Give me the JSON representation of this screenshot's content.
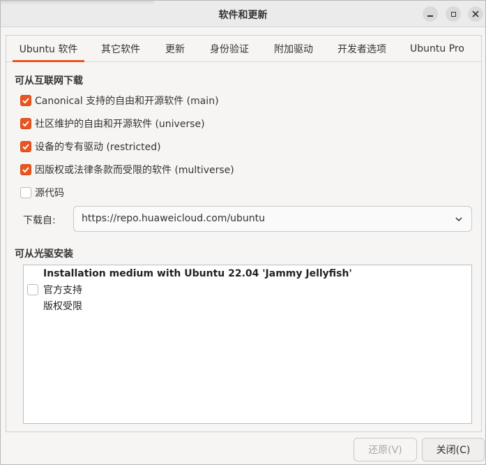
{
  "window": {
    "title": "软件和更新"
  },
  "tabs": [
    {
      "label": "Ubuntu 软件",
      "active": true
    },
    {
      "label": "其它软件",
      "active": false
    },
    {
      "label": "更新",
      "active": false
    },
    {
      "label": "身份验证",
      "active": false
    },
    {
      "label": "附加驱动",
      "active": false
    },
    {
      "label": "开发者选项",
      "active": false
    },
    {
      "label": "Ubuntu Pro",
      "active": false
    }
  ],
  "internet": {
    "heading": "可从互联网下载",
    "items": [
      {
        "label": "Canonical 支持的自由和开源软件 (main)",
        "checked": true
      },
      {
        "label": "社区维护的自由和开源软件 (universe)",
        "checked": true
      },
      {
        "label": "设备的专有驱动 (restricted)",
        "checked": true
      },
      {
        "label": "因版权或法律条款而受限的软件 (multiverse)",
        "checked": true
      },
      {
        "label": "源代码",
        "checked": false
      }
    ],
    "download_from_label": "下载自:",
    "download_from_value": "https://repo.huaweicloud.com/ubuntu"
  },
  "cdrom": {
    "heading": "可从光驱安装",
    "media_title": "Installation medium with Ubuntu 22.04 'Jammy Jellyfish'",
    "lines": [
      "官方支持",
      "版权受限"
    ],
    "checked": false
  },
  "buttons": {
    "revert": "还原(V)",
    "close": "关闭(C)"
  },
  "colors": {
    "accent": "#e95420"
  },
  "icons": {
    "minimize": "minimize-icon",
    "maximize": "maximize-icon",
    "close": "close-icon",
    "dropdown": "chevron-down-icon",
    "check": "checkmark-icon"
  }
}
